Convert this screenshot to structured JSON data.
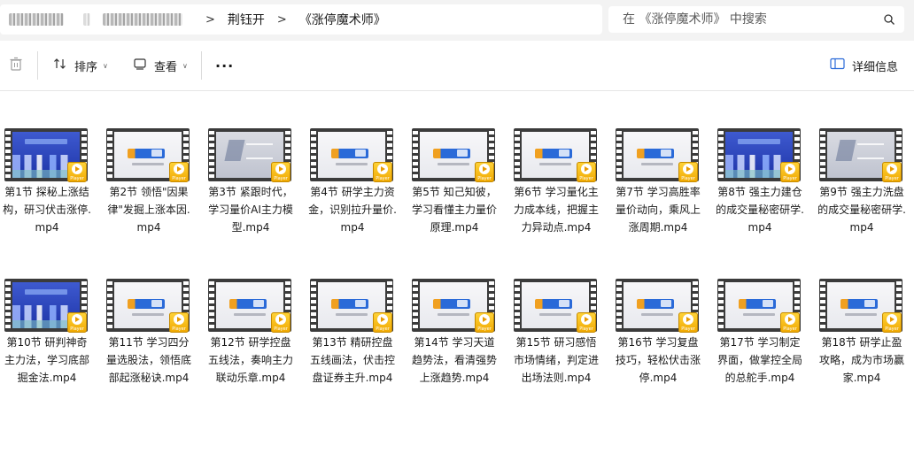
{
  "address": {
    "crumbs": [
      "荆钰开",
      "《涨停魔术师》"
    ],
    "separator": ">",
    "search_placeholder": "在 《涨停魔术师》 中搜索"
  },
  "toolbar": {
    "sort_label": "排序",
    "view_label": "查看",
    "more_label": "···",
    "details_label": "详细信息"
  },
  "player_label": "Player",
  "files": [
    {
      "name": "第1节 探秘上涨结构，研习伏击涨停.mp4",
      "thumb": "blue"
    },
    {
      "name": "第2节 领悟\"因果律\"发掘上涨本因.mp4",
      "thumb": "white"
    },
    {
      "name": "第3节 紧跟时代，学习量价AI主力模型.mp4",
      "thumb": "grey"
    },
    {
      "name": "第4节 研学主力资金，识别拉升量价.mp4",
      "thumb": "white"
    },
    {
      "name": "第5节 知己知彼，学习看懂主力量价原理.mp4",
      "thumb": "white"
    },
    {
      "name": "第6节 学习量化主力成本线，把握主力异动点.mp4",
      "thumb": "white"
    },
    {
      "name": "第7节 学习高胜率量价动向，乘风上涨周期.mp4",
      "thumb": "white"
    },
    {
      "name": "第8节 强主力建仓的成交量秘密研学.mp4",
      "thumb": "blue"
    },
    {
      "name": "第9节 强主力洗盘的成交量秘密研学.mp4",
      "thumb": "grey"
    },
    {
      "name": "第10节 研判神奇主力法，学习底部掘金法.mp4",
      "thumb": "blue"
    },
    {
      "name": "第11节 学习四分量选股法，领悟底部起涨秘诀.mp4",
      "thumb": "white"
    },
    {
      "name": "第12节 研学控盘五线法，奏响主力联动乐章.mp4",
      "thumb": "white"
    },
    {
      "name": "第13节 精研控盘五线画法，伏击控盘证券主升.mp4",
      "thumb": "white"
    },
    {
      "name": "第14节 学习天道趋势法，看清强势上涨趋势.mp4",
      "thumb": "white"
    },
    {
      "name": "第15节 研习感悟市场情绪，判定进出场法则.mp4",
      "thumb": "white"
    },
    {
      "name": "第16节 学习复盘技巧，轻松伏击涨停.mp4",
      "thumb": "white"
    },
    {
      "name": "第17节 学习制定界面，做掌控全局的总舵手.mp4",
      "thumb": "white"
    },
    {
      "name": "第18节 研学止盈攻略，成为市场赢家.mp4",
      "thumb": "white"
    }
  ]
}
